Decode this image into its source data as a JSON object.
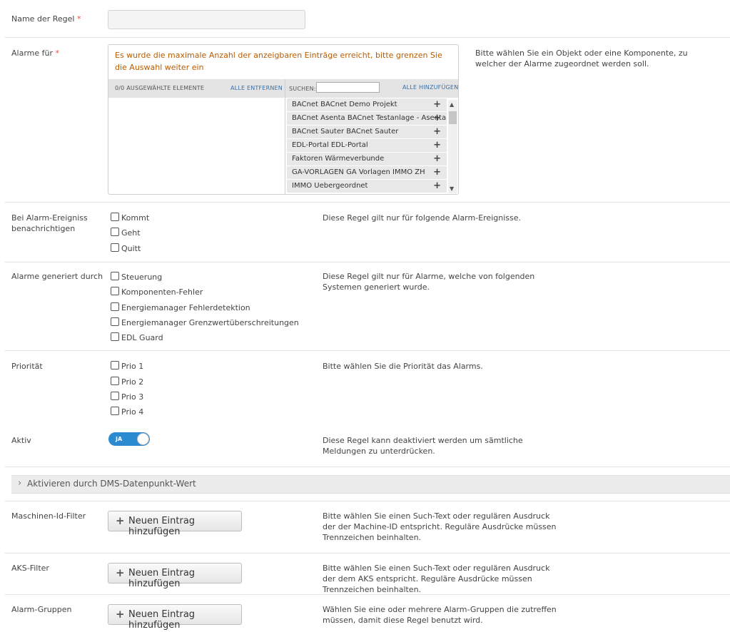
{
  "rule_name": {
    "label": "Name der Regel",
    "required": "*",
    "value": ""
  },
  "alarms_for": {
    "label": "Alarme für",
    "required": "*",
    "warning": "Es wurde die maximale Anzahl der anzeigbaren Einträge erreicht, bitte grenzen Sie die Auswahl weiter ein",
    "selected_count": "0/0 AUSGEWÄHLTE ELEMENTE",
    "remove_all": "ALLE ENTFERNEN",
    "search_label": "SUCHEN:",
    "search_value": "",
    "add_all": "ALLE HINZUFÜGEN",
    "options": [
      "BACnet BACnet Demo Projekt",
      "BACnet Asenta BACnet Testanlage - Asenta",
      "BACnet Sauter BACnet Sauter",
      "EDL-Portal EDL-Portal",
      "Faktoren Wärmeverbunde",
      "GA-VORLAGEN GA Vorlagen IMMO ZH",
      "IMMO Uebergeordnet"
    ],
    "plus": "+",
    "help": "Bitte wählen Sie ein Objekt oder eine Komponente, zu welcher der Alarme zugeordnet werden soll."
  },
  "events": {
    "label": "Bei Alarm-Ereigniss benachrichtigen",
    "options": [
      "Kommt",
      "Geht",
      "Quitt"
    ],
    "help": "Diese Regel gilt nur für folgende Alarm-Ereignisse."
  },
  "generated_by": {
    "label": "Alarme generiert durch",
    "options": [
      "Steuerung",
      "Komponenten-Fehler",
      "Energiemanager Fehlerdetektion",
      "Energiemanager Grenzwertüberschreitungen",
      "EDL Guard"
    ],
    "help": "Diese Regel gilt nur für Alarme, welche von folgenden Systemen generiert wurde."
  },
  "priority": {
    "label": "Priorität",
    "options": [
      "Prio 1",
      "Prio 2",
      "Prio 3",
      "Prio 4"
    ],
    "help": "Bitte wählen Sie die Priorität das Alarms."
  },
  "active": {
    "label": "Aktiv",
    "toggle_label": "JA",
    "help": "Diese Regel kann deaktiviert werden um sämtliche Meldungen zu unterdrücken."
  },
  "accordion": {
    "chevron": "›",
    "label": "Aktivieren durch DMS-Datenpunkt-Wert"
  },
  "machine_filter": {
    "label": "Maschinen-Id-Filter",
    "button": "Neuen Eintrag hinzufügen",
    "help": "Bitte wählen Sie einen Such-Text oder regulären Ausdruck der der Machine-ID entspricht. Reguläre Ausdrücke müssen Trennzeichen beinhalten."
  },
  "aks_filter": {
    "label": "AKS-Filter",
    "button": "Neuen Eintrag hinzufügen",
    "help": "Bitte wählen Sie einen Such-Text oder regulären Ausdruck der dem AKS entspricht. Reguläre Ausdrücke müssen Trennzeichen beinhalten."
  },
  "alarm_groups": {
    "label": "Alarm-Gruppen",
    "button": "Neuen Eintrag hinzufügen",
    "help": "Wählen Sie eine oder mehrere Alarm-Gruppen die zutreffen müssen, damit diese Regel benutzt wird."
  },
  "icons": {
    "plus": "plus-icon",
    "chevron": "chevron-right-icon"
  },
  "colors": {
    "required": "#d9534f",
    "warning": "#b85c00",
    "toggle": "#2c8ad1",
    "link": "#3a6fa8"
  }
}
